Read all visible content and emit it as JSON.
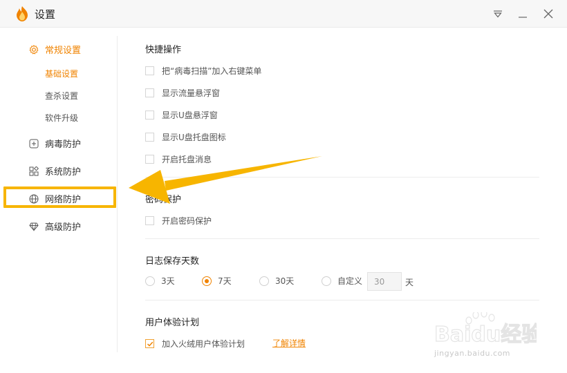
{
  "window": {
    "title": "设置"
  },
  "sidebar": {
    "general": {
      "label": "常规设置",
      "icon": "gear-icon"
    },
    "sub_items": [
      {
        "label": "基础设置",
        "active": true
      },
      {
        "label": "查杀设置",
        "active": false
      },
      {
        "label": "软件升级",
        "active": false
      }
    ],
    "items": [
      {
        "label": "病毒防护",
        "icon": "plus-square-icon"
      },
      {
        "label": "系统防护",
        "icon": "grid-icon"
      },
      {
        "label": "网络防护",
        "icon": "globe-icon"
      },
      {
        "label": "高级防护",
        "icon": "diamond-icon"
      }
    ]
  },
  "shortcuts": {
    "title": "快捷操作",
    "options": [
      {
        "label": "把“病毒扫描”加入右键菜单",
        "checked": false
      },
      {
        "label": "显示流量悬浮窗",
        "checked": false
      },
      {
        "label": "显示U盘悬浮窗",
        "checked": false
      },
      {
        "label": "显示U盘托盘图标",
        "checked": false
      },
      {
        "label": "开启托盘消息",
        "checked": false
      }
    ]
  },
  "password": {
    "title": "密码保护",
    "option": {
      "label": "开启密码保护",
      "checked": false
    }
  },
  "log_days": {
    "title": "日志保存天数",
    "options": [
      {
        "label": "3天",
        "checked": false
      },
      {
        "label": "7天",
        "checked": true
      },
      {
        "label": "30天",
        "checked": false
      },
      {
        "label": "自定义",
        "checked": false
      }
    ],
    "custom_value": "30",
    "unit": "天"
  },
  "experience": {
    "title": "用户体验计划",
    "option": {
      "label": "加入火绒用户体验计划",
      "checked": true
    },
    "link": "了解详情"
  },
  "watermark": {
    "brand": "Baidu经验",
    "url": "jingyan.baidu.com"
  },
  "colors": {
    "accent": "#f08300",
    "highlight": "#f7b500"
  }
}
